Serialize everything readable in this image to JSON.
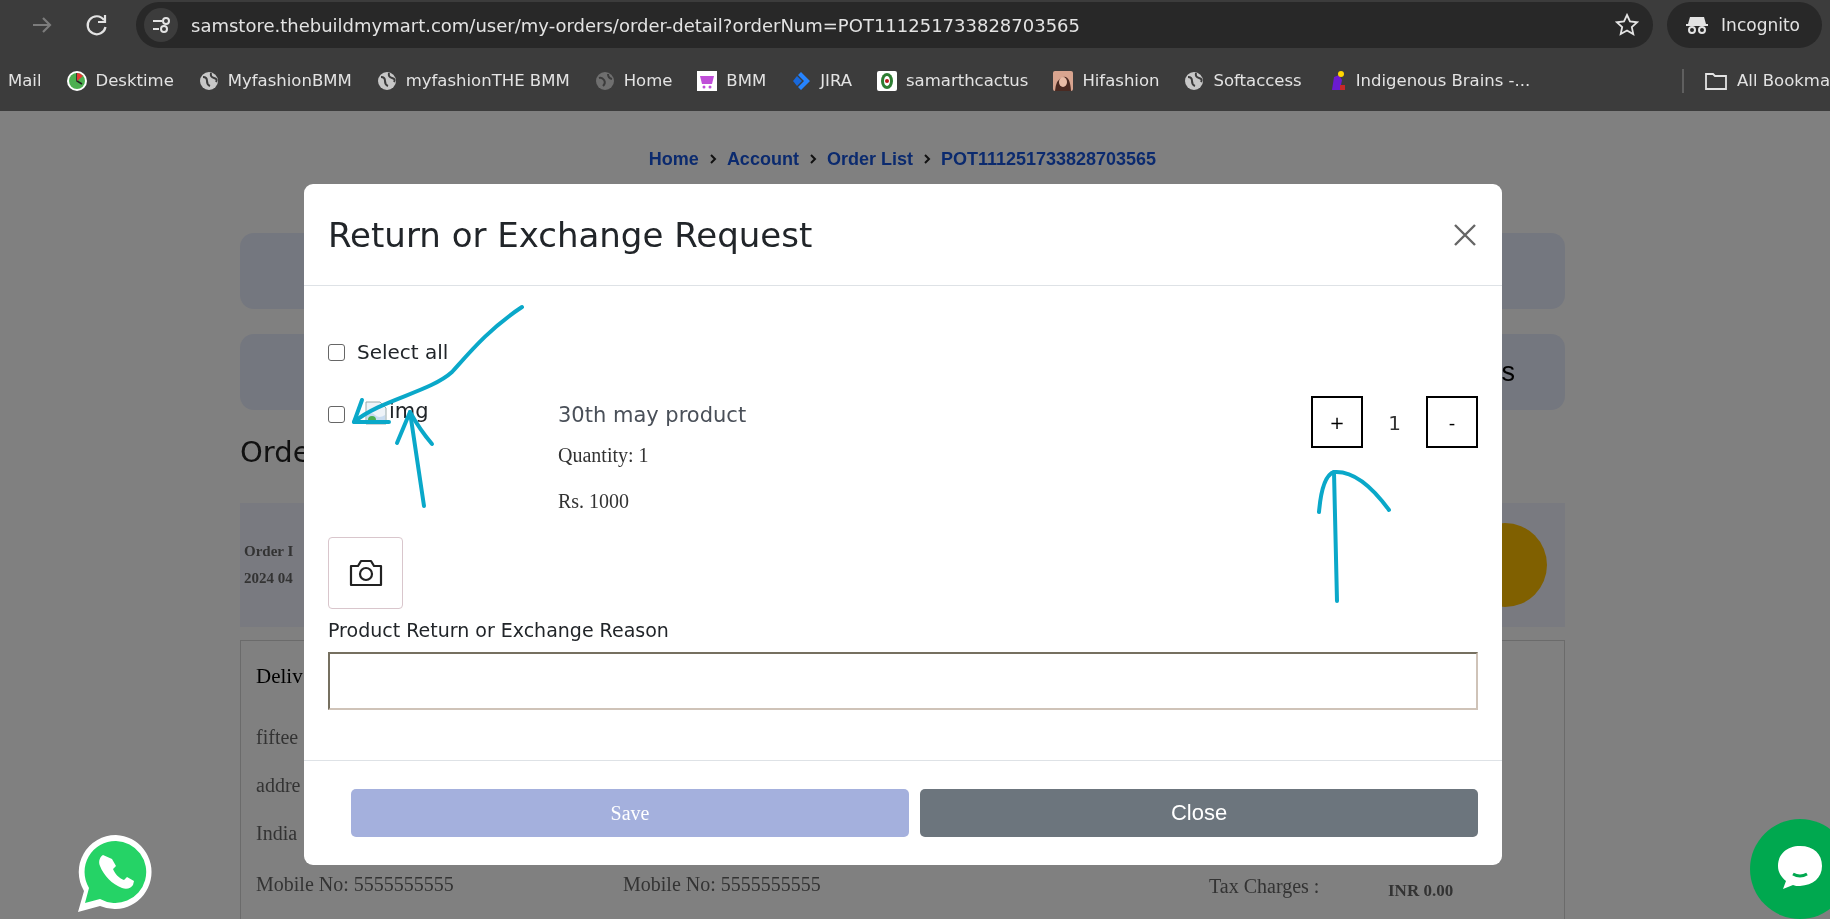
{
  "browser": {
    "url": "samstore.thebuildmymart.com/user/my-orders/order-detail?orderNum=POT111251733828703565",
    "profile": "Incognito",
    "bookmarks": [
      {
        "label": "Mail",
        "kind": "none"
      },
      {
        "label": "Desktime",
        "kind": "clock"
      },
      {
        "label": "MyfashionBMM",
        "kind": "globe"
      },
      {
        "label": "myfashionTHE BMM",
        "kind": "globe"
      },
      {
        "label": "Home",
        "kind": "earth"
      },
      {
        "label": "BMM",
        "kind": "cart"
      },
      {
        "label": "JIRA",
        "kind": "jira"
      },
      {
        "label": "samarthcactus",
        "kind": "ring"
      },
      {
        "label": "Hifashion",
        "kind": "portrait"
      },
      {
        "label": "Softaccess",
        "kind": "globe"
      },
      {
        "label": "Indigenous Brains -...",
        "kind": "figure"
      }
    ],
    "all_bookmarks": "All Bookma"
  },
  "page": {
    "breadcrumb": [
      "Home",
      "Account",
      "Order List",
      "POT111251733828703565"
    ],
    "card_text": "s",
    "section_title": "Orde",
    "order_info": [
      "Order I",
      "2024 04"
    ],
    "delivery": {
      "title": "Deliv",
      "lines": [
        "fiftee",
        "addre",
        "India"
      ],
      "footer": [
        "Mobile No: 5555555555",
        "Mobile No: 5555555555",
        "Tax Charges :",
        "INR 0.00"
      ]
    }
  },
  "modal": {
    "title": "Return or Exchange Request",
    "select_all": {
      "label": "Select all",
      "checked": false
    },
    "items": [
      {
        "checked": false,
        "image_alt": "img",
        "name": "30th may product",
        "quantity": "Quantity: 1",
        "price": "Rs. 1000",
        "plus": "+",
        "count": "1",
        "minus": "-"
      }
    ],
    "reason_label": "Product Return or Exchange Reason",
    "buttons": [
      {
        "label": "Save",
        "kind": "primary",
        "disabled": true
      },
      {
        "label": "Close",
        "kind": "secondary",
        "disabled": false
      }
    ]
  }
}
